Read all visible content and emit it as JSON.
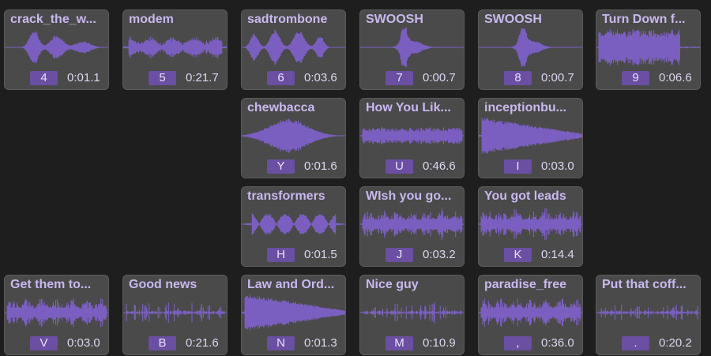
{
  "colors": {
    "background": "#1e1e1e",
    "pad": "#4a4a4a",
    "accent": "#7b5fc0",
    "key_badge": "#6a4fa3",
    "title": "#c9b8ee"
  },
  "pads": [
    {
      "title": "crack_the_w...",
      "key": "4",
      "duration": "0:01.1"
    },
    {
      "title": "modem",
      "key": "5",
      "duration": "0:21.7"
    },
    {
      "title": "sadtrombone",
      "key": "6",
      "duration": "0:03.6"
    },
    {
      "title": "SWOOSH",
      "key": "7",
      "duration": "0:00.7"
    },
    {
      "title": "SWOOSH",
      "key": "8",
      "duration": "0:00.7"
    },
    {
      "title": "Turn Down f...",
      "key": "9",
      "duration": "0:06.6"
    },
    {
      "title": "chewbacca",
      "key": "Y",
      "duration": "0:01.6"
    },
    {
      "title": "How You Lik...",
      "key": "U",
      "duration": "0:46.6"
    },
    {
      "title": "inceptionbu...",
      "key": "I",
      "duration": "0:03.0"
    },
    {
      "title": "transformers",
      "key": "H",
      "duration": "0:01.5"
    },
    {
      "title": "WIsh you go...",
      "key": "J",
      "duration": "0:03.2"
    },
    {
      "title": "You got leads",
      "key": "K",
      "duration": "0:14.4"
    },
    {
      "title": "Get them to...",
      "key": "V",
      "duration": "0:03.0"
    },
    {
      "title": "Good news",
      "key": "B",
      "duration": "0:21.6"
    },
    {
      "title": "Law and Ord...",
      "key": "N",
      "duration": "0:01.3"
    },
    {
      "title": "Nice guy",
      "key": "M",
      "duration": "0:10.9"
    },
    {
      "title": "paradise_free",
      "key": ",",
      "duration": "0:36.0"
    },
    {
      "title": "Put that coff...",
      "key": ".",
      "duration": "0:20.2"
    }
  ]
}
